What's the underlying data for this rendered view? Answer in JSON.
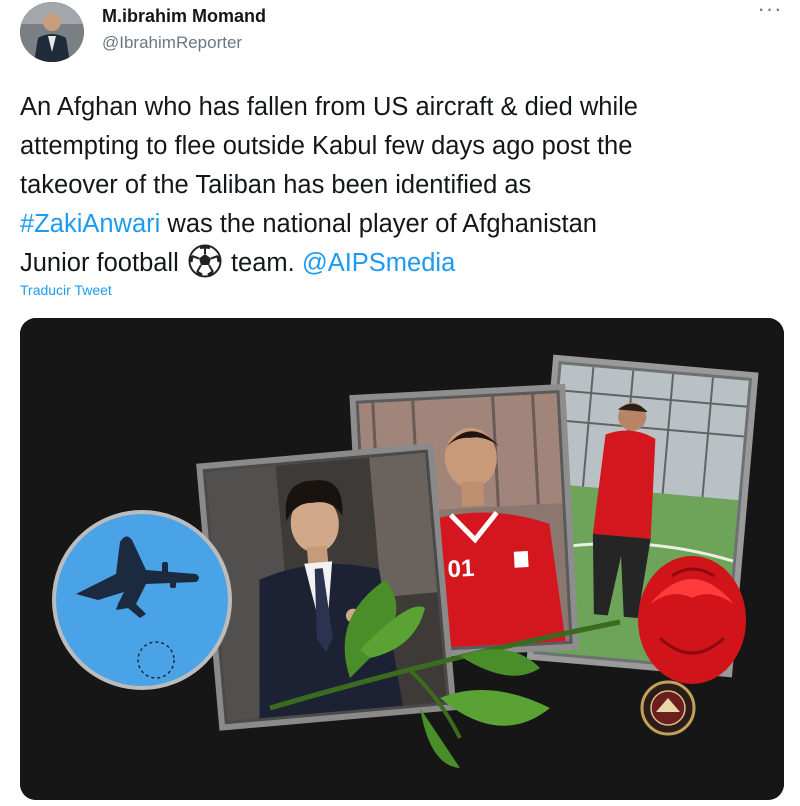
{
  "author": {
    "name": "M.ibrahim Momand",
    "handle": "@IbrahimReporter"
  },
  "tweet": {
    "lines": [
      "An Afghan who has fallen from US aircraft & died while",
      "attempting to flee outside Kabul few days ago post the",
      "takeover of the Taliban has been identified as"
    ],
    "hashtag": "#ZakiAnwari",
    "line4_rest": " was the national player of Afghanistan",
    "line5_start": "Junior football ",
    "line5_mid": " team. ",
    "mention": "@AIPSmedia"
  },
  "translate_label": "Traducir Tweet",
  "media": {
    "jersey_text": "01",
    "icons": [
      "airplane-icon",
      "rose-icon",
      "emblem-icon",
      "soccer-ball-icon"
    ]
  },
  "colors": {
    "link": "#1d9bf0",
    "media_background": "#161616",
    "jersey_red": "#d4161e",
    "sky_blue": "#4aa3e6"
  }
}
